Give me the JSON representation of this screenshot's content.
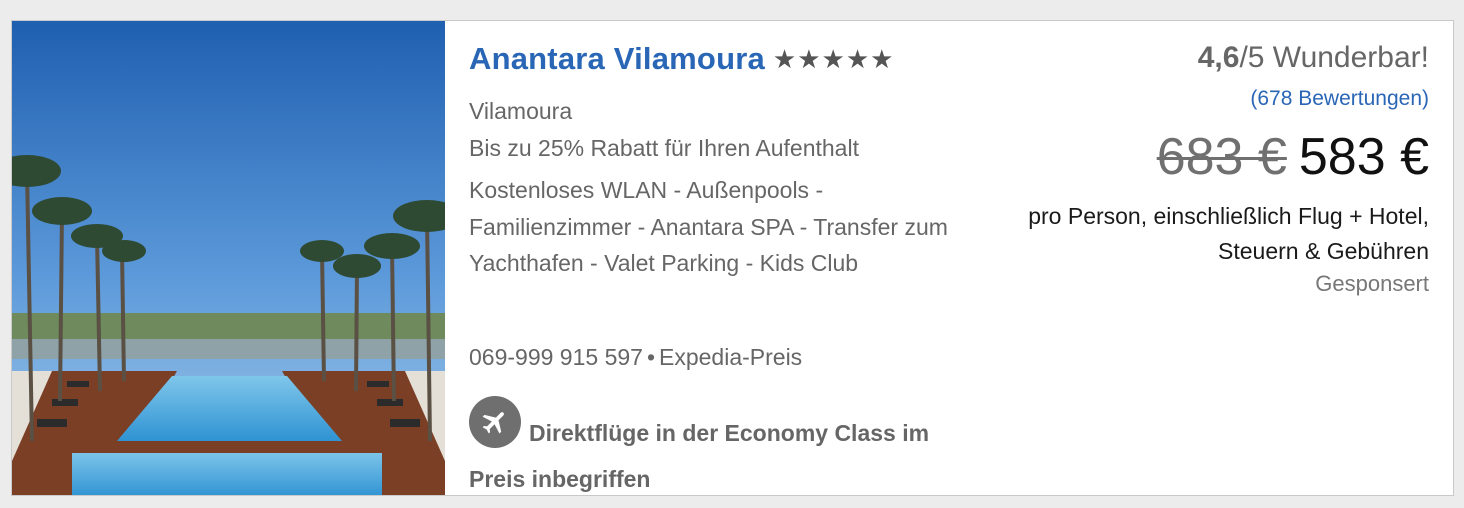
{
  "hotel": {
    "name": "Anantara Vilamoura",
    "stars": "★★★★★",
    "location": "Vilamoura",
    "discount": "Bis zu 25% Rabatt für Ihren Aufenthalt",
    "amenities": "Kostenloses WLAN - Außenpools - Familienzimmer - Anantara SPA - Transfer zum Yachthafen - Valet Parking - Kids Club",
    "phone": "069-999 915 597",
    "separator": "•",
    "price_source": "Expedia-Preis",
    "flight_icon": "airplane-icon",
    "flight_text": "Direktflüge in der Economy Class im Preis inbegriffen"
  },
  "rating": {
    "score": "4,6",
    "scale": "/5 Wunderbar!",
    "reviews": "(678 Bewertungen)"
  },
  "pricing": {
    "old_price": "683 €",
    "new_price": "583 €",
    "note": "pro Person, einschließlich Flug + Hotel, Steuern & Gebühren",
    "sponsored": "Gesponsert"
  },
  "colors": {
    "link_blue": "#2a66b6",
    "text_gray": "#666666",
    "badge_gray": "#6f6f6f"
  }
}
